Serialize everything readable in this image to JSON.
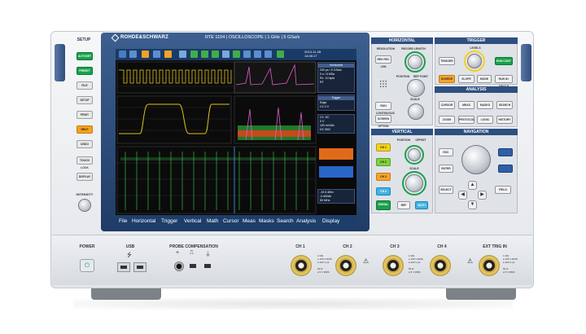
{
  "brand": "ROHDE&SCHWARZ",
  "model": "RTE 1104  |  OSCILLOSCOPE  |  1 GHz  |  5 GSa/s",
  "setup": {
    "title": "SETUP",
    "buttons": [
      "AUTOSET",
      "PRESET",
      "FILE",
      "SETUP",
      "PRINT",
      "HELP",
      "UNDO",
      "TOUCH LOCK",
      "DISPLAY"
    ],
    "intensity_label": "INTENSITY"
  },
  "screen": {
    "clock": "2013-11-28\n14:06:17",
    "side_horizontal": {
      "title": "Horizontal",
      "lines": [
        "200 ps / 5 GSa/s",
        "0 s / 5 MSa",
        "RL: 10 kpts",
        "RT"
      ]
    },
    "side_trigger": {
      "title": "Trigger",
      "lines": [
        "Edge",
        "C1 0 V"
      ]
    },
    "side_channel": {
      "lines": [
        "C1: DC",
        "0 V",
        "100 mV/div",
        "DC 50Ω"
      ]
    },
    "side_bottom": {
      "lines": [
        "-19.5 dBm",
        "-9 dB/div",
        "50 MHz"
      ]
    },
    "menu": [
      "File",
      "Horizontal",
      "Trigger",
      "Vertical",
      "Math",
      "Cursor",
      "Meas",
      "Masks",
      "Search",
      "Analysis",
      "Display"
    ]
  },
  "horizontal": {
    "title": "HORIZONTAL",
    "labels": {
      "resolution": "RESOLUTION",
      "record_length": "RECORD LENGTH",
      "position": "POSITION",
      "ref_point": "REF POINT",
      "scale": "SCALE"
    },
    "keys": [
      "RES REC LEN",
      "RUN CONTINUOUS",
      "SCREEN OPTION"
    ]
  },
  "trigger": {
    "title": "TRIGGER",
    "levels_label": "LEVELS",
    "keys": [
      "TRIGGER",
      "RUN CONT",
      "SOURCE",
      "SLOPE",
      "MODE",
      "RUN N× SINGLE"
    ]
  },
  "analysis": {
    "title": "ANALYSIS",
    "keys": [
      "CURSOR",
      "MEAS",
      "MASKS",
      "SEARCH",
      "ZOOM",
      "PROTOCOL",
      "LOGIC",
      "HISTORY"
    ]
  },
  "vertical": {
    "title": "VERTICAL",
    "labels": {
      "position": "POSITION",
      "offset": "OFFSET",
      "scale": "SCALE"
    },
    "keys": [
      "CH 1",
      "CH 2",
      "CH 3",
      "CH 4",
      "SIGNAL OFF",
      "REF",
      "MATH"
    ]
  },
  "navigation": {
    "title": "NAVIGATION",
    "keys": [
      "ESC",
      "ENTER",
      "SELECT",
      "FIELD"
    ]
  },
  "bottom": {
    "power_label": "POWER",
    "usb_label": "USB",
    "probe_label": "PROBE COMPENSATION",
    "channels": [
      "CH 1",
      "CH 2",
      "CH 3",
      "CH 4"
    ],
    "ext_trig": "EXT TRIG IN",
    "spec_50": "1 MΩ\n≤ 150 V RMS\n≤ 400 V pk",
    "spec_1m": "50 Ω\n≤ 5 V RMS"
  },
  "colors": {
    "ch1_yellow": "#f5d11c",
    "ch2_green": "#7fd33a",
    "ch3_orange": "#f6a52a",
    "ch4_cyan": "#3fb4e6",
    "accent_blue": "#2e4f7f"
  }
}
